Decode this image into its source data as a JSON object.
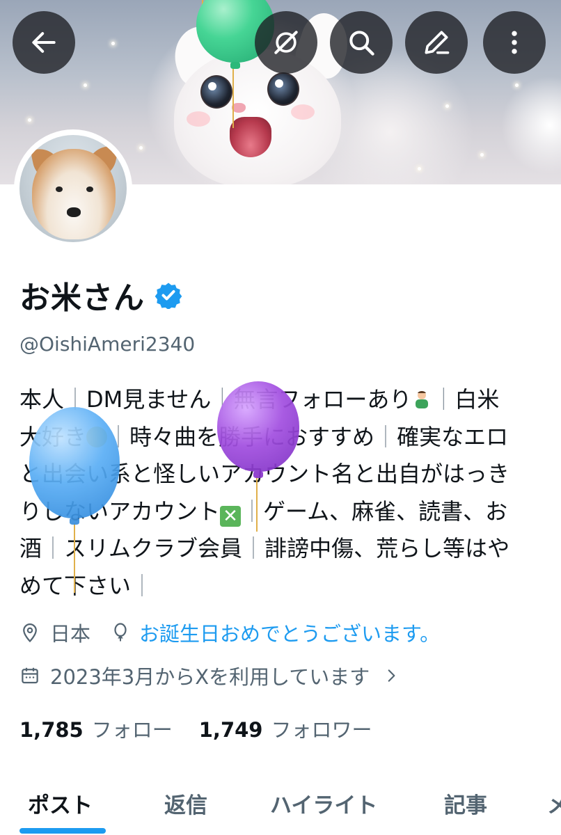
{
  "header": {
    "back_icon": "arrow-left-icon",
    "grok_icon": "grok-icon",
    "search_icon": "search-icon",
    "edit_icon": "pencil-icon",
    "more_icon": "more-vertical-icon"
  },
  "profile": {
    "display_name": "お米さん",
    "verified": true,
    "handle": "@OishiAmeri2340",
    "bio": {
      "l1a": "本人",
      "l1b": "DM見ません",
      "l1c": "無言フォローあり",
      "l1d": "白米",
      "l2a": "大好き",
      "l2b": "時々曲を勝手におすすめ",
      "l2c": "確実なエロ",
      "l3": "と出会い系と怪しいアカウント名と出自がはっき",
      "l4a": "りしないアカウント",
      "l4b": "ゲーム、麻雀、読書、お",
      "l5a": "酒",
      "l5b": "スリムクラブ会員",
      "l5c": "誹謗中傷、荒らし等はや",
      "l6": "めて下さい"
    },
    "location": "日本",
    "birthday_text": "お誕生日おめでとうございます。",
    "joined": "2023年3月からXを利用しています",
    "following_count": "1,785",
    "following_label": "フォロー",
    "followers_count": "1,749",
    "followers_label": "フォロワー"
  },
  "tabs": [
    {
      "label": "ポスト",
      "active": true
    },
    {
      "label": "返信",
      "active": false
    },
    {
      "label": "ハイライト",
      "active": false
    },
    {
      "label": "記事",
      "active": false
    },
    {
      "label": "メ",
      "active": false
    }
  ],
  "colors": {
    "accent": "#1d9bf0",
    "muted": "#536471",
    "balloon_green": "#3fd08f",
    "balloon_purple": "#a24fe0",
    "balloon_blue": "#4aa6f2"
  }
}
